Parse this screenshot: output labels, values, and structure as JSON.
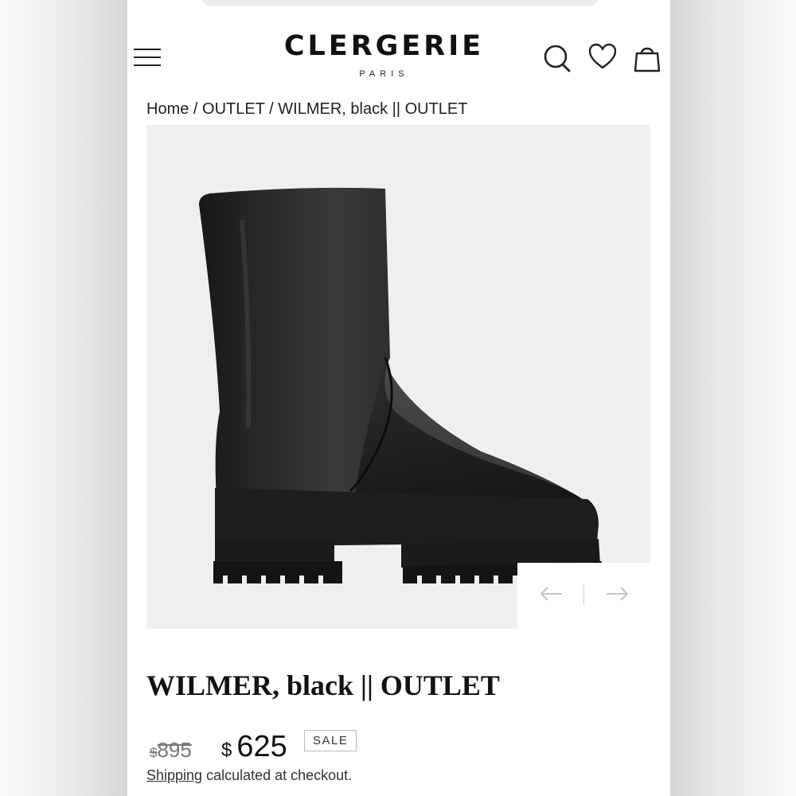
{
  "header": {
    "logo_main": "CLERGERIE",
    "logo_sub": "PARIS",
    "icons": [
      "menu-icon",
      "search-icon",
      "heart-icon",
      "bag-icon"
    ]
  },
  "breadcrumb": {
    "items": [
      "Home",
      "OUTLET",
      "WILMER, black || OUTLET"
    ],
    "separator": "/"
  },
  "gallery": {
    "prev_icon": "arrow-left-icon",
    "next_icon": "arrow-right-icon"
  },
  "product": {
    "title": "WILMER, black || OUTLET",
    "currency": "$",
    "original_price": "895",
    "sale_price": "625",
    "badge": "SALE",
    "shipping_link": "Shipping",
    "shipping_text": " calculated at checkout."
  },
  "colors": {
    "text": "#222222",
    "image_bg": "#efefef",
    "old_price": "#777777"
  }
}
